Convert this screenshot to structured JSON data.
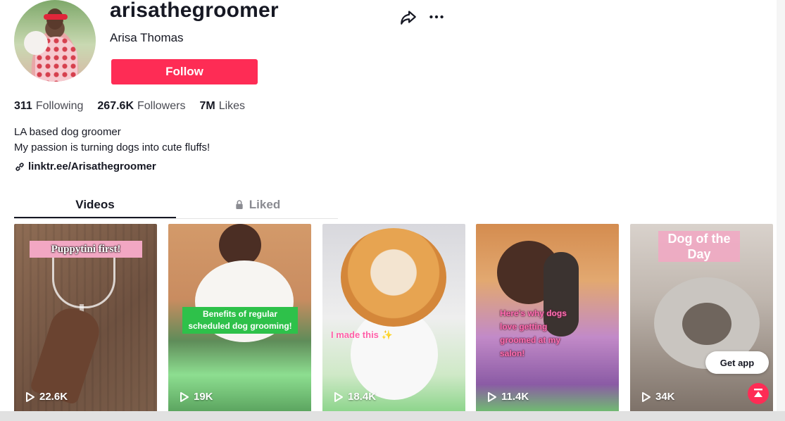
{
  "profile": {
    "username": "arisathegroomer",
    "full_name": "Arisa Thomas",
    "follow_label": "Follow",
    "bio_line1": "LA based dog groomer",
    "bio_line2": "My passion is turning dogs into cute fluffs!",
    "link": "linktr.ee/Arisathegroomer"
  },
  "stats": [
    {
      "value": "311",
      "label": "Following"
    },
    {
      "value": "267.6K",
      "label": "Followers"
    },
    {
      "value": "7M",
      "label": "Likes"
    }
  ],
  "tabs": {
    "videos": "Videos",
    "liked": "Liked"
  },
  "videos": [
    {
      "caption": "Puppytini first!",
      "views": "22.6K"
    },
    {
      "caption": "Benefits of regular scheduled dog grooming!",
      "views": "19K"
    },
    {
      "caption": "I made this ✨",
      "views": "18.4K"
    },
    {
      "caption": "Here's why dogs love getting groomed at my salon!",
      "views": "11.4K"
    },
    {
      "caption": "Dog of the Day",
      "views": "34K"
    }
  ],
  "floating": {
    "get_app_label": "Get app"
  },
  "colors": {
    "accent": "#fe2c55",
    "text": "#161823",
    "muted": "#8a8b91"
  },
  "icons": [
    "share-icon",
    "more-icon",
    "link-icon",
    "lock-icon",
    "play-icon",
    "back-to-top-icon"
  ]
}
